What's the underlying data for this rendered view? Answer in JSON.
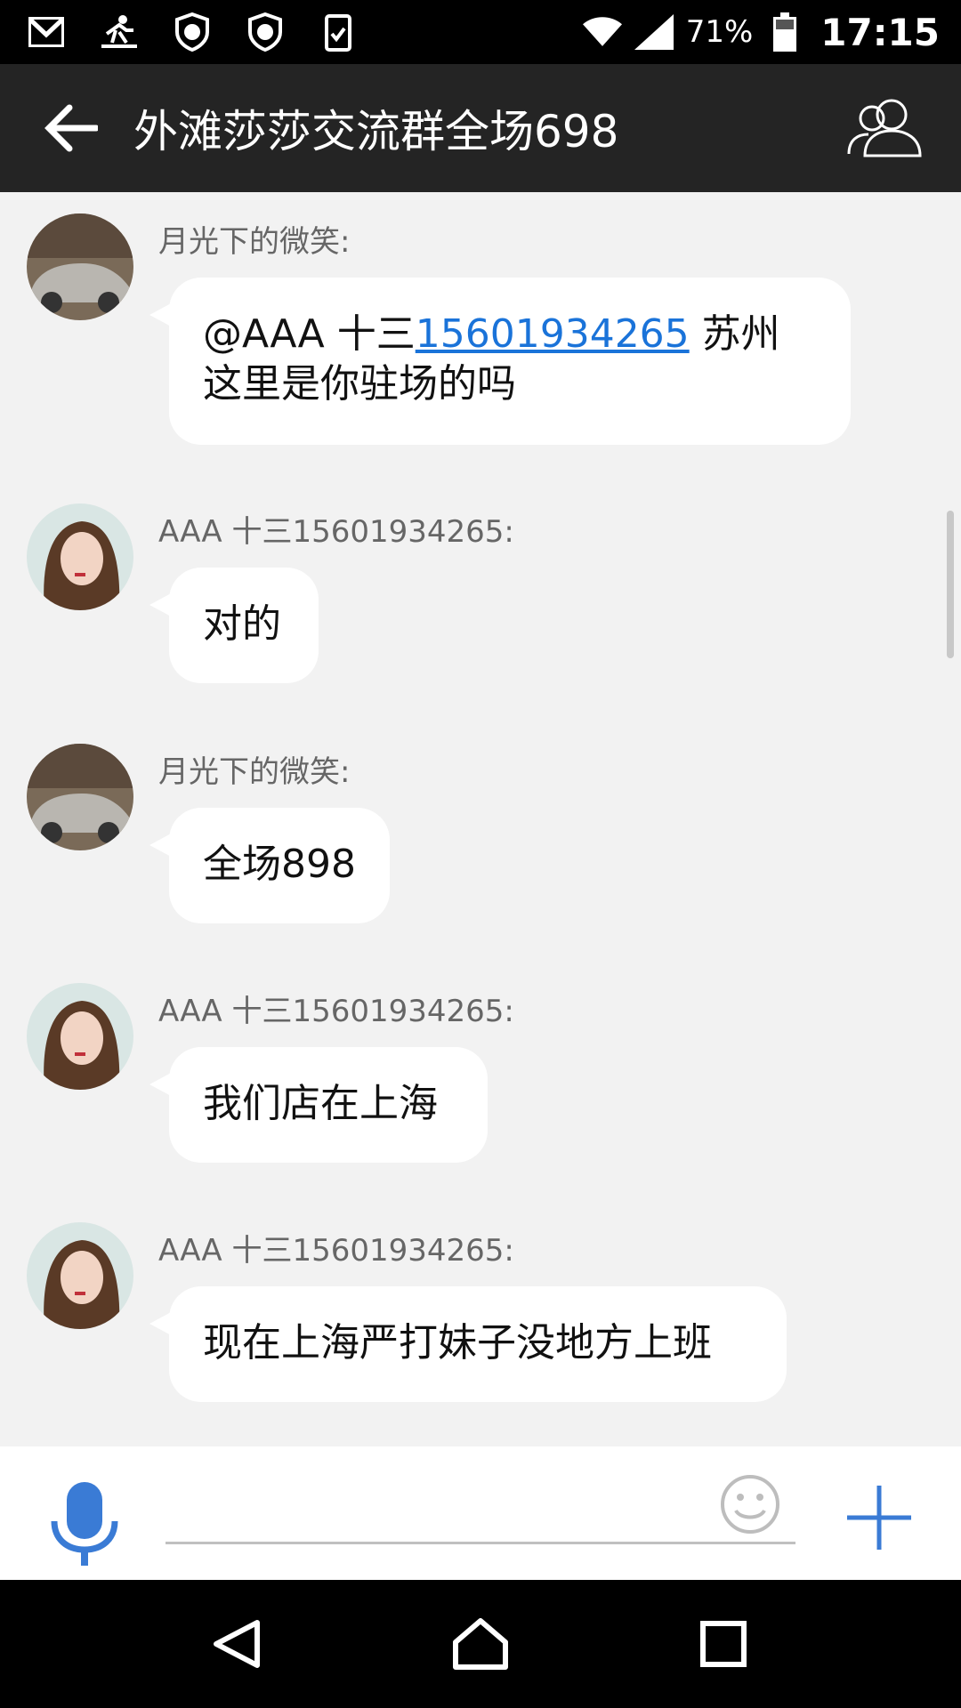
{
  "status_bar": {
    "battery_percent": "71%",
    "time": "17:15",
    "icons": [
      "gmail-icon",
      "delivery-icon",
      "shield-y-icon",
      "shield-y-icon",
      "clipboard-check-icon",
      "wifi-icon",
      "signal-icon",
      "battery-icon"
    ]
  },
  "header": {
    "title": "外滩莎莎交流群全场698",
    "back_icon": "arrow-left-icon",
    "members_icon": "group-members-icon"
  },
  "messages": [
    {
      "sender": "月光下的微笑:",
      "avatar": "car-avatar",
      "text_before": "@AAA   十三",
      "link": "15601934265",
      "text_after": " 苏州",
      "text_line2": "这里是你驻场的吗"
    },
    {
      "sender": "AAA   十三15601934265:",
      "avatar": "woman-avatar",
      "text": "对的"
    },
    {
      "sender": "月光下的微笑:",
      "avatar": "car-avatar",
      "text": "全场898"
    },
    {
      "sender": "AAA   十三15601934265:",
      "avatar": "woman-avatar",
      "text": "我们店在上海"
    },
    {
      "sender": "AAA   十三15601934265:",
      "avatar": "woman-avatar",
      "text": "现在上海严打妹子没地方上班"
    }
  ],
  "input_bar": {
    "placeholder": "",
    "value": "",
    "colors": {
      "accent": "#3a7bd5"
    }
  },
  "nav": [
    "back-triangle-icon",
    "home-icon",
    "recents-icon"
  ]
}
